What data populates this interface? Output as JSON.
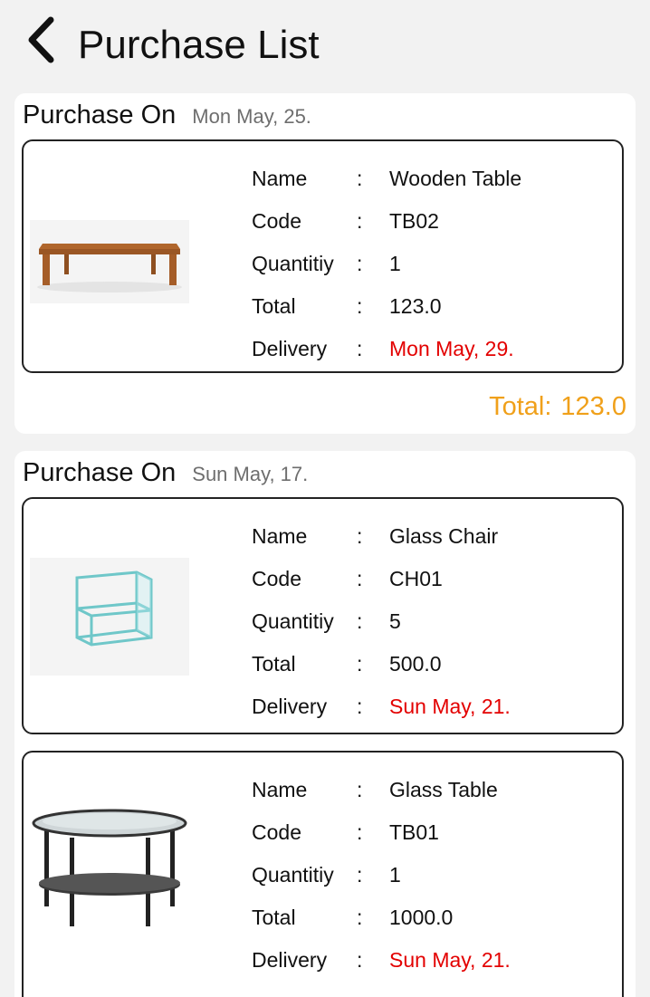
{
  "header": {
    "title": "Purchase List",
    "back_icon": "chevron-left-icon"
  },
  "colors": {
    "background": "#f2f2f2",
    "card": "#ffffff",
    "delivery_red": "#e30000",
    "total_orange": "#f0a01a",
    "date_gray": "#6e6e6e"
  },
  "labels": {
    "purchase_on": "Purchase On",
    "name": "Name",
    "code": "Code",
    "quantity": "Quantitiy",
    "total": "Total",
    "delivery": "Delivery",
    "separator": ":",
    "group_total": "Total:"
  },
  "groups": [
    {
      "date": "Mon May, 25.",
      "total": "123.0",
      "items": [
        {
          "image": "wooden-table-image",
          "name": "Wooden Table",
          "code": "TB02",
          "quantity": "1",
          "total": "123.0",
          "delivery": "Mon May, 29."
        }
      ]
    },
    {
      "date": "Sun May, 17.",
      "items": [
        {
          "image": "glass-chair-image",
          "name": "Glass Chair",
          "code": "CH01",
          "quantity": "5",
          "total": "500.0",
          "delivery": "Sun May, 21."
        },
        {
          "image": "glass-table-image",
          "name": "Glass Table",
          "code": "TB01",
          "quantity": "1",
          "total": "1000.0",
          "delivery": "Sun May, 21."
        }
      ]
    }
  ]
}
